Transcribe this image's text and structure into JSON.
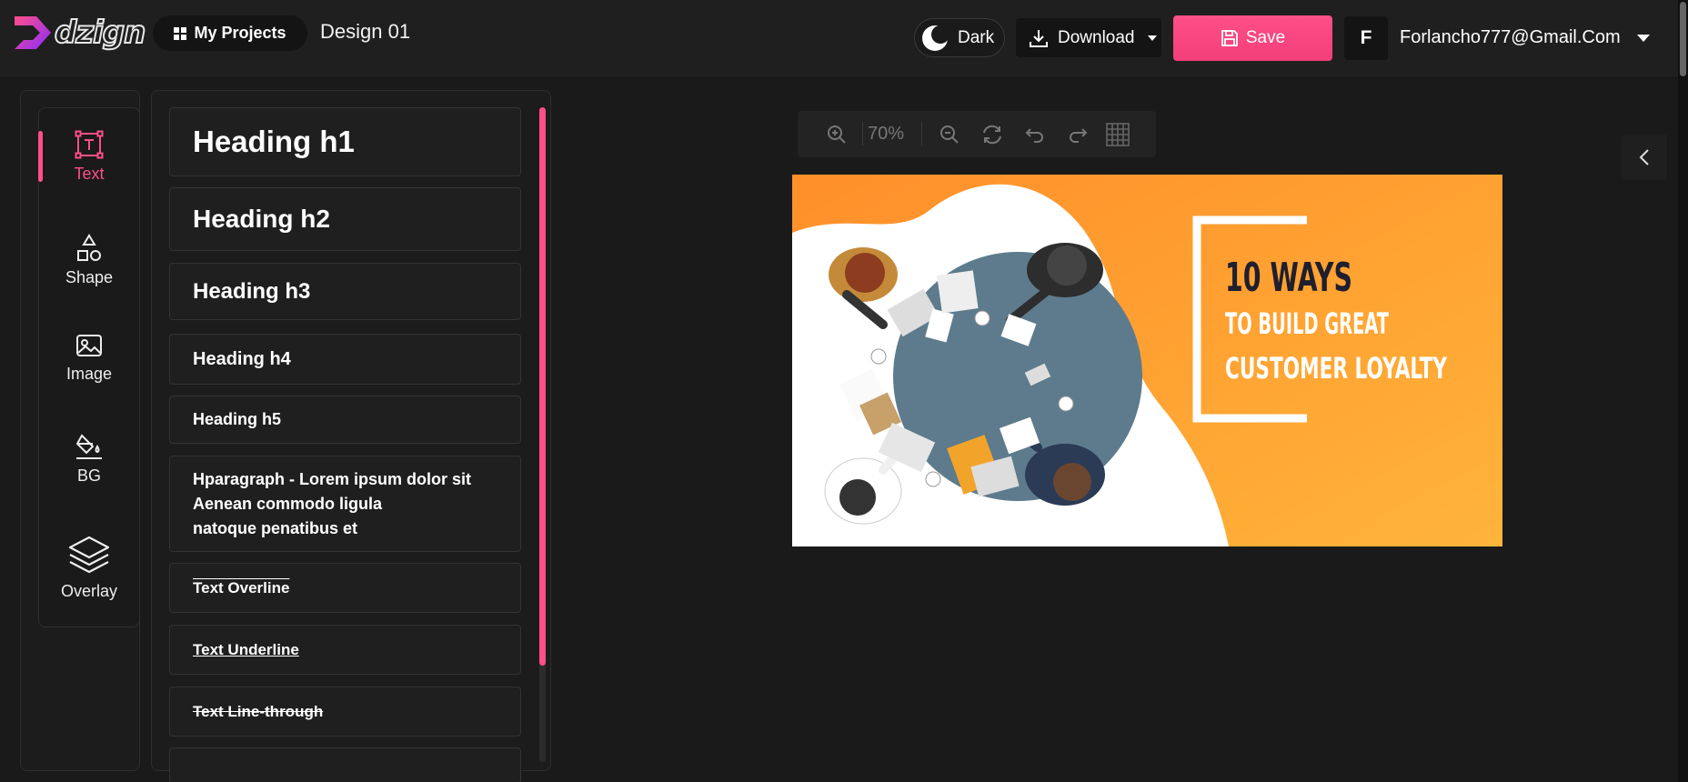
{
  "brand": {
    "logo_text": "dzign",
    "accent": "#ff4f88"
  },
  "header": {
    "projects_label": "My Projects",
    "document_title": "Design 01",
    "theme_label": "Dark",
    "download_label": "Download",
    "save_label": "Save",
    "user_initial": "F",
    "user_email": "Forlancho777@Gmail.Com"
  },
  "tools": [
    {
      "label": "Text",
      "icon": "text-box-icon",
      "active": true
    },
    {
      "label": "Shape",
      "icon": "shapes-icon",
      "active": false
    },
    {
      "label": "Image",
      "icon": "image-icon",
      "active": false
    },
    {
      "label": "BG",
      "icon": "paint-bucket-icon",
      "active": false
    },
    {
      "label": "Overlay",
      "icon": "layers-icon",
      "active": false
    }
  ],
  "text_presets": [
    {
      "label": "Heading h1"
    },
    {
      "label": "Heading h2"
    },
    {
      "label": "Heading h3"
    },
    {
      "label": "Heading h4"
    },
    {
      "label": "Heading h5"
    },
    {
      "label": "Hparagraph - Lorem ipsum dolor sit\nAenean commodo ligula\nnatoque penatibus et"
    },
    {
      "label": "Text Overline"
    },
    {
      "label": "Text Underline"
    },
    {
      "label": "Text Line-through"
    }
  ],
  "toolbar": {
    "zoom": "70%"
  },
  "design": {
    "headline": "10 WAYS",
    "subline1": "TO BUILD GREAT",
    "subline2": "CUSTOMER LOYALTY",
    "colors": {
      "orange": "#ff8f2a",
      "orange_light": "#ffb43a",
      "table": "#5d7b8c",
      "headline": "#1f1f2e"
    }
  }
}
